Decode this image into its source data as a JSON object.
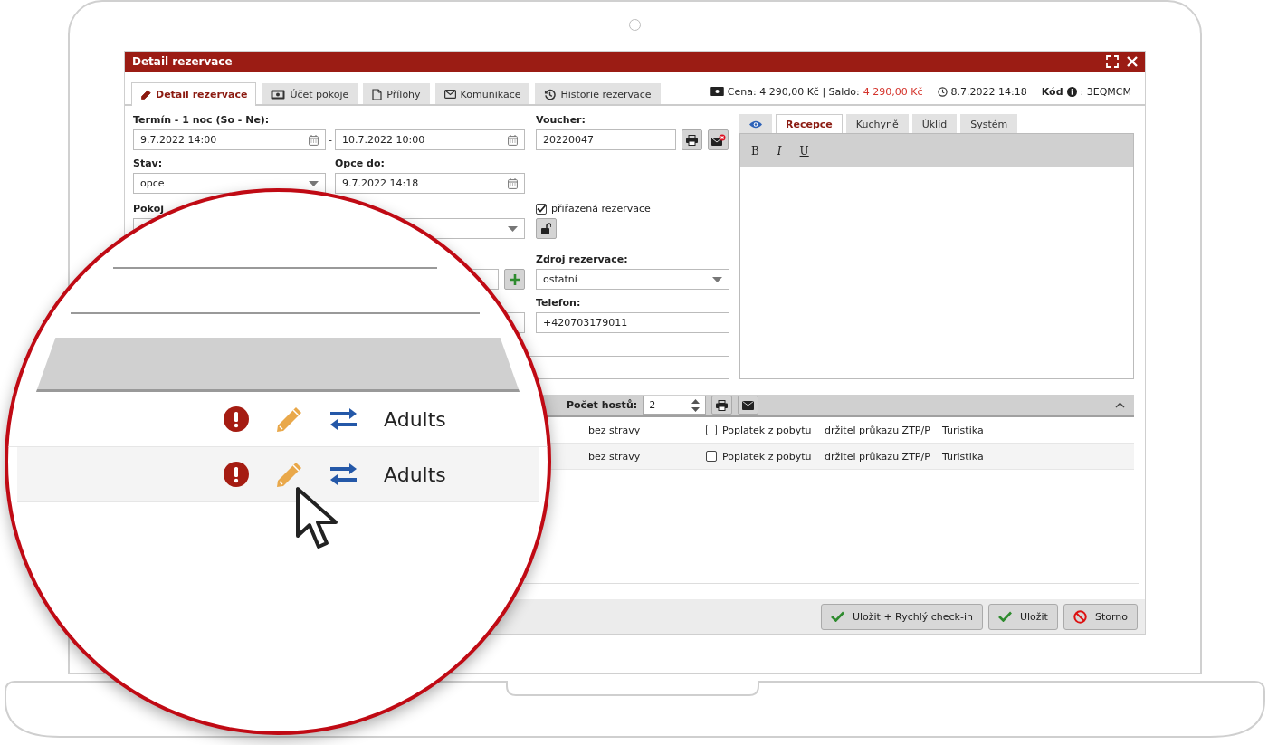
{
  "window": {
    "title": "Detail rezervace"
  },
  "tabs": [
    {
      "label": "Detail rezervace",
      "selected": true
    },
    {
      "label": "Účet pokoje",
      "selected": false
    },
    {
      "label": "Přílohy",
      "selected": false
    },
    {
      "label": "Komunikace",
      "selected": false
    },
    {
      "label": "Historie rezervace",
      "selected": false
    }
  ],
  "summary": {
    "price": "Cena: 4 290,00 Kč | Saldo:",
    "balance": "4 290,00 Kč",
    "created": "8.7.2022 14:18",
    "code_label": "Kód",
    "code": ": 3EQMCM"
  },
  "form": {
    "term": {
      "label": "Termín - 1 noc (So - Ne):",
      "from": "9.7.2022 14:00",
      "separator": "-",
      "to": "10.7.2022 10:00"
    },
    "status": {
      "label": "Stav:",
      "value": "opce"
    },
    "option_until": {
      "label": "Opce do:",
      "value": "9.7.2022 14:18"
    },
    "room": {
      "label": "Pokoj"
    },
    "voucher": {
      "label": "Voucher:",
      "value": "20220047"
    },
    "assigned": {
      "label": "přiřazená rezervace",
      "checked": true
    },
    "source": {
      "label": "Zdroj rezervace:",
      "value": "ostatní"
    },
    "phone": {
      "label": "Telefon:",
      "value": "+420703179011"
    }
  },
  "notes": {
    "tabs": [
      {
        "kind": "icon",
        "selected": false
      },
      {
        "kind": "text",
        "label": "Recepce",
        "selected": true
      },
      {
        "kind": "text",
        "label": "Kuchyně",
        "selected": false
      },
      {
        "kind": "text",
        "label": "Úklid",
        "selected": false
      },
      {
        "kind": "text",
        "label": "Systém",
        "selected": false
      }
    ],
    "toolbar": [
      "B",
      "I",
      "U"
    ]
  },
  "guests": {
    "count_label": "Počet hostů:",
    "count": "2",
    "rows": [
      {
        "board": "bez stravy",
        "fee": {
          "label": "Poplatek z pobytu",
          "checked": false
        },
        "discount": "držitel průkazu ZTP/P",
        "purpose": "Turistika"
      },
      {
        "board": "bez stravy",
        "fee": {
          "label": "Poplatek z pobytu",
          "checked": false
        },
        "discount": "držitel průkazu ZTP/P",
        "purpose": "Turistika"
      }
    ]
  },
  "footer": {
    "buttons": [
      {
        "label": "Uložit + Rychlý check-in",
        "kind": "confirm"
      },
      {
        "label": "Uložit",
        "kind": "confirm"
      },
      {
        "label": "Storno",
        "kind": "cancel"
      }
    ]
  },
  "magnifier": {
    "rows": [
      {
        "type": "Adults"
      },
      {
        "type": "Adults"
      }
    ]
  }
}
